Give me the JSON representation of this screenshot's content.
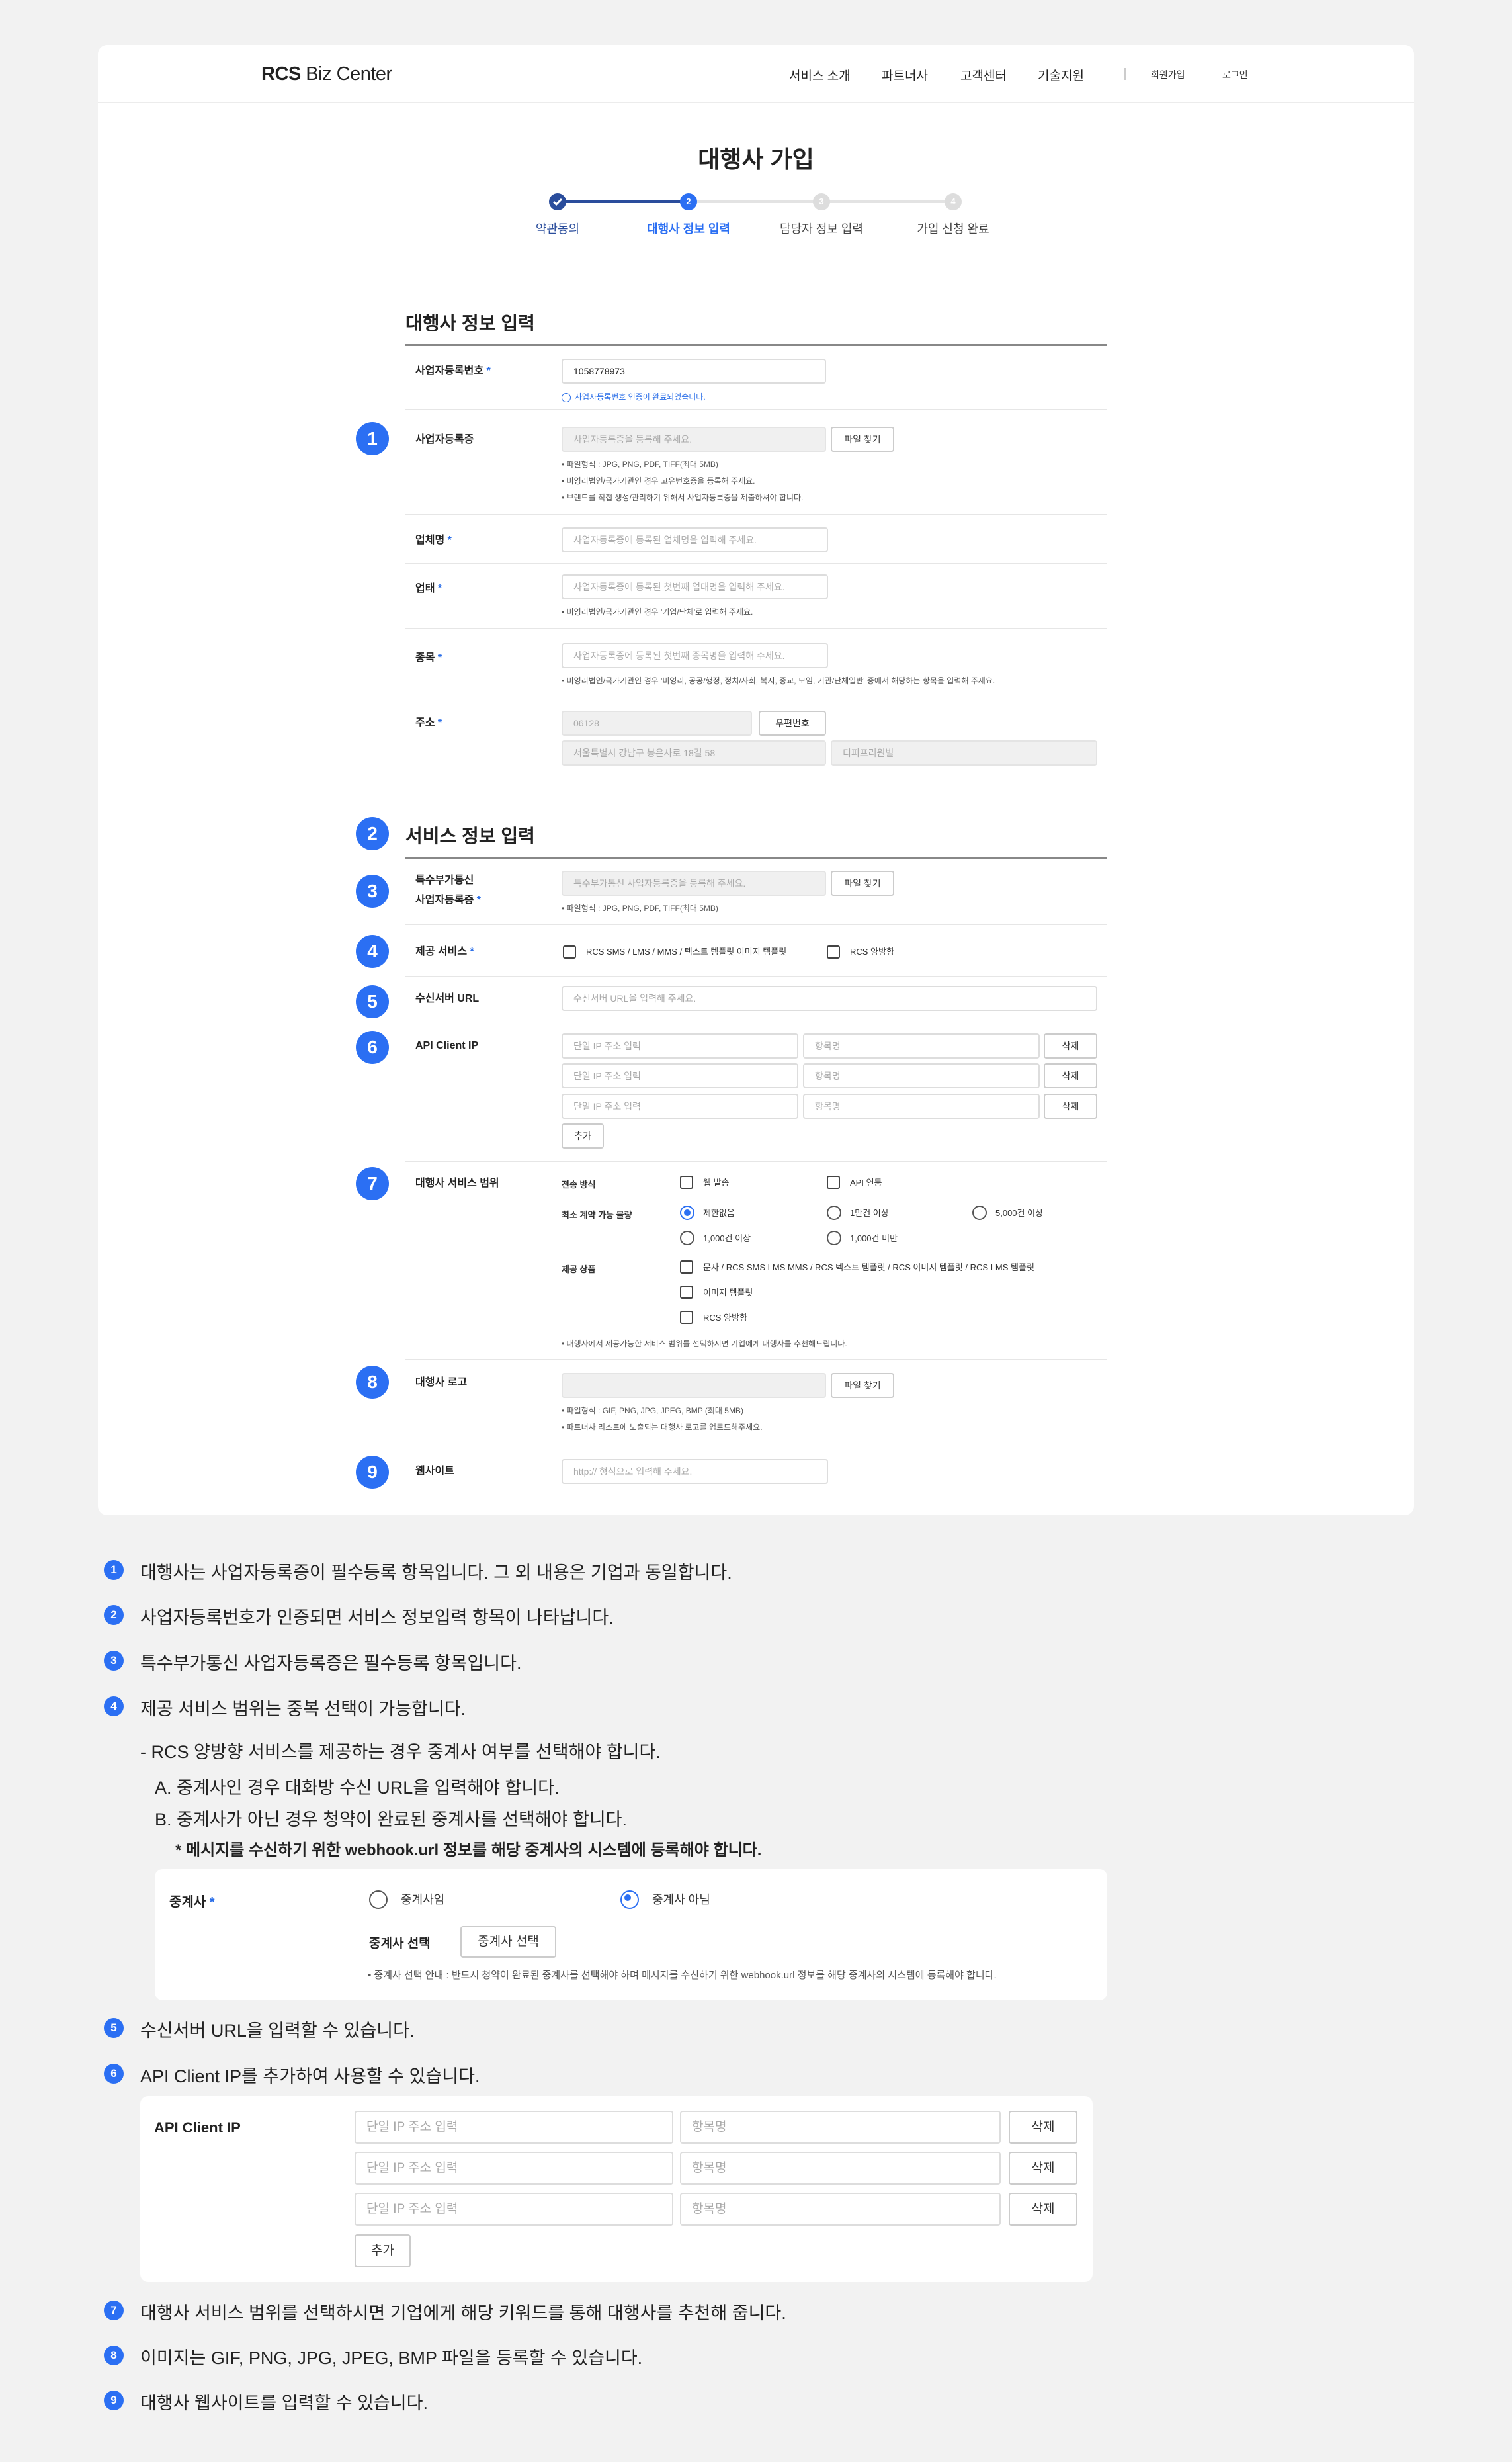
{
  "header": {
    "logo_bold": "RCS",
    "logo_rest": " Biz Center",
    "nav": [
      "서비스 소개",
      "파트너사",
      "고객센터",
      "기술지원"
    ],
    "join": "회원가입",
    "login": "로그인"
  },
  "page": {
    "title": "대행사 가입"
  },
  "steps": [
    {
      "num": "",
      "label": "약관동의"
    },
    {
      "num": "2",
      "label": "대행사 정보 입력"
    },
    {
      "num": "3",
      "label": "담당자 정보 입력"
    },
    {
      "num": "4",
      "label": "가입 신청 완료"
    }
  ],
  "agency": {
    "section_title": "대행사 정보 입력",
    "bizno": {
      "label": "사업자등록번호",
      "req": "*",
      "value": "1058778973",
      "verified": "사업자등록번호 인증이 완료되었습니다."
    },
    "bizcert": {
      "label": "사업자등록증",
      "placeholder": "사업자등록증을 등록해 주세요.",
      "button": "파일 찾기",
      "notes": [
        "파일형식 : JPG, PNG, PDF, TIFF(최대 5MB)",
        "비영리법인/국가기관인 경우 고유번호증을 등록해 주세요.",
        "브랜드를 직접 생성/관리하기 위해서 사업자등록증을 제출하셔야 합니다."
      ]
    },
    "company": {
      "label": "업체명",
      "req": "*",
      "placeholder": "사업자등록증에 등록된 업체명을 입력해 주세요."
    },
    "bizcond": {
      "label": "업태",
      "req": "*",
      "placeholder": "사업자등록증에 등록된 첫번째 업태명을 입력해 주세요.",
      "note": "비영리법인/국가기관인 경우 '기업/단체'로 입력해 주세요."
    },
    "biztype": {
      "label": "종목",
      "req": "*",
      "placeholder": "사업자등록증에 등록된 첫번째 종목명을 입력해 주세요.",
      "note": "비영리법인/국가기관인 경우 '비영리, 공공/행정, 정치/사회, 복지, 종교, 모임, 기관/단체일반' 중에서 해당하는 항목을 입력해 주세요."
    },
    "address": {
      "label": "주소",
      "req": "*",
      "zip": "06128",
      "zip_button": "우편번호",
      "addr1": "서울특별시 강남구 봉은사로 18길 58",
      "addr2": "디피프리원빌"
    }
  },
  "service": {
    "section_title": "서비스 정보 입력",
    "vas": {
      "label1": "특수부가통신",
      "label2": "사업자등록증",
      "req": "*",
      "placeholder": "특수부가통신 사업자등록증을 등록해 주세요.",
      "button": "파일 찾기",
      "note": "파일형식 : JPG, PNG, PDF, TIFF(최대 5MB)"
    },
    "provide": {
      "label": "제공 서비스",
      "req": "*",
      "opt1": "RCS SMS / LMS / MMS / 텍스트 템플릿 이미지 템플릿",
      "opt2": "RCS 양방향"
    },
    "recv": {
      "label": "수신서버 URL",
      "placeholder": "수신서버 URL을 입력해 주세요."
    },
    "apiip": {
      "label": "API Client IP",
      "ip_placeholder": "단일 IP 주소 입력",
      "name_placeholder": "항목명",
      "delete": "삭제",
      "add": "추가"
    },
    "scope": {
      "label": "대행사 서비스 범위",
      "send_label": "전송 방식",
      "send_opts": [
        "웹 발송",
        "API 연동"
      ],
      "min_label": "최소 계약 가능 물량",
      "min_opts": [
        "제한없음",
        "1만건 이상",
        "5,000건 이상",
        "1,000건 이상",
        "1,000건 미만"
      ],
      "prod_label": "제공 상품",
      "prod_opts": [
        "문자 / RCS SMS LMS MMS / RCS 텍스트 템플릿 / RCS 이미지 템플릿 / RCS LMS 템플릿",
        "이미지 템플릿",
        "RCS 양방향"
      ],
      "note": "대행사에서 제공가능한 서비스 범위를 선택하시면 기업에게 대행사를 추천해드립니다."
    },
    "logo": {
      "label": "대행사 로고",
      "button": "파일 찾기",
      "notes": [
        "파일형식 : GIF, PNG, JPG, JPEG, BMP (최대 5MB)",
        "파트너사 리스트에 노출되는 대행사 로고를 업로드해주세요."
      ]
    },
    "site": {
      "label": "웹사이트",
      "placeholder": "http:// 형식으로 입력해 주세요."
    }
  },
  "badges": [
    "1",
    "2",
    "3",
    "4",
    "5",
    "6",
    "7",
    "8",
    "9"
  ],
  "explain": {
    "e1": "대행사는 사업자등록증이 필수등록 항목입니다. 그 외 내용은 기업과 동일합니다.",
    "e2": "사업자등록번호가 인증되면 서비스 정보입력 항목이 나타납니다.",
    "e3": "특수부가통신 사업자등록증은 필수등록 항목입니다.",
    "e4": "제공 서비스 범위는 중복 선택이 가능합니다.",
    "e4a": "-  RCS 양방향 서비스를 제공하는 경우 중계사 여부를 선택해야 합니다.",
    "e4b": "A. 중계사인 경우 대화방 수신 URL을 입력해야 합니다.",
    "e4c": "B. 중계사가 아닌 경우 청약이 완료된 중계사를 선택해야 합니다.",
    "e4d": "* 메시지를 수신하기 위한 webhook.url 정보를 해당 중계사의 시스템에 등록해야 합니다.",
    "e5": "수신서버 URL을 입력할 수 있습니다.",
    "e6": "API Client IP를 추가하여 사용할 수 있습니다.",
    "e7": "대행사 서비스 범위를 선택하시면 기업에게 해당 키워드를 통해 대행사를 추천해 줍니다.",
    "e8": "이미지는 GIF, PNG, JPG, JPEG, BMP 파일을 등록할 수 있습니다.",
    "e9": "대행사 웹사이트를 입력할 수 있습니다."
  },
  "relay": {
    "label": "중계사",
    "req": "*",
    "opt1": "중계사임",
    "opt2": "중계사 아님",
    "select_label": "중계사 선택",
    "select_button": "중계사 선택",
    "note": "중계사 선택 안내 : 반드시 청약이 완료된 중계사를 선택해야 하며 메시지를 수신하기 위한 webhook.url 정보를 해당 중계사의 시스템에 등록해야 합니다."
  },
  "apibox": {
    "label": "API Client IP",
    "ip_placeholder": "단일 IP 주소 입력",
    "name_placeholder": "항목명",
    "delete": "삭제",
    "add": "추가"
  },
  "colors": {
    "accent": "#2b6ff3",
    "step_done": "#2a4d9c",
    "bg": "#f2f2f2"
  }
}
